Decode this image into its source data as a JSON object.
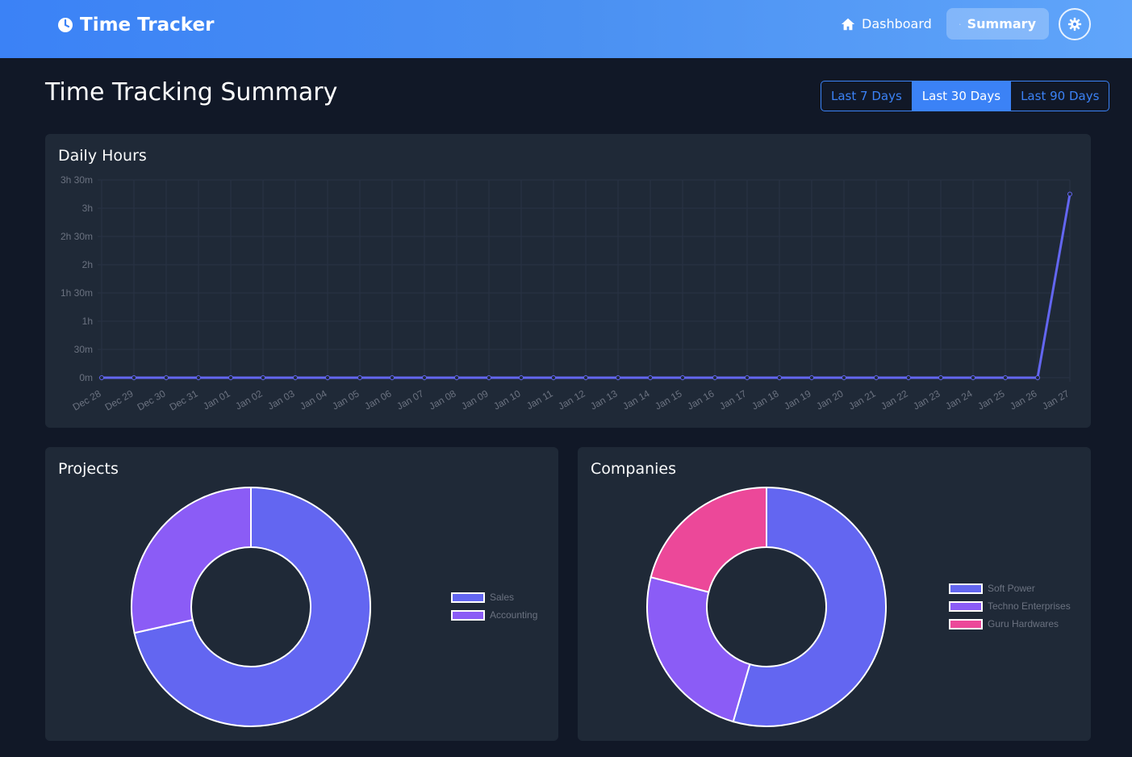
{
  "app": {
    "title": "Time Tracker",
    "nav": [
      {
        "label": "Dashboard",
        "icon": "home-icon",
        "active": false
      },
      {
        "label": "Summary",
        "icon": "bar-chart-icon",
        "active": true
      }
    ],
    "theme_icon": "gear-icon"
  },
  "page": {
    "title": "Time Tracking Summary",
    "ranges": [
      "Last 7 Days",
      "Last 30 Days",
      "Last 90 Days"
    ],
    "active_range": "Last 30 Days"
  },
  "colors": {
    "accent": "#3b82f6",
    "line": "#6366f1",
    "sales": "#6366f1",
    "accounting": "#8b5cf6",
    "soft_power": "#6366f1",
    "techno": "#8b5cf6",
    "guru": "#ec4899"
  },
  "cards": {
    "daily_title": "Daily Hours",
    "projects_title": "Projects",
    "companies_title": "Companies"
  },
  "chart_data": [
    {
      "type": "line",
      "title": "Daily Hours",
      "x": [
        "Dec 28",
        "Dec 29",
        "Dec 30",
        "Dec 31",
        "Jan 01",
        "Jan 02",
        "Jan 03",
        "Jan 04",
        "Jan 05",
        "Jan 06",
        "Jan 07",
        "Jan 08",
        "Jan 09",
        "Jan 10",
        "Jan 11",
        "Jan 12",
        "Jan 13",
        "Jan 14",
        "Jan 15",
        "Jan 16",
        "Jan 17",
        "Jan 18",
        "Jan 19",
        "Jan 20",
        "Jan 21",
        "Jan 22",
        "Jan 23",
        "Jan 24",
        "Jan 25",
        "Jan 26",
        "Jan 27"
      ],
      "y_minutes": [
        0,
        0,
        0,
        0,
        0,
        0,
        0,
        0,
        0,
        0,
        0,
        0,
        0,
        0,
        0,
        0,
        0,
        0,
        0,
        0,
        0,
        0,
        0,
        0,
        0,
        0,
        0,
        0,
        0,
        0,
        195
      ],
      "y_ticks": [
        "0m",
        "30m",
        "1h",
        "1h 30m",
        "2h",
        "2h 30m",
        "3h",
        "3h 30m"
      ],
      "ylim_minutes": [
        0,
        210
      ],
      "grid": true
    },
    {
      "type": "pie",
      "title": "Projects",
      "labels": [
        "Sales",
        "Accounting"
      ],
      "values": [
        71.5,
        28.5
      ],
      "legend": "right"
    },
    {
      "type": "pie",
      "title": "Companies",
      "labels": [
        "Soft Power",
        "Techno Enterprises",
        "Guru Hardwares"
      ],
      "values": [
        54.5,
        24.5,
        21.0
      ],
      "legend": "right"
    }
  ]
}
